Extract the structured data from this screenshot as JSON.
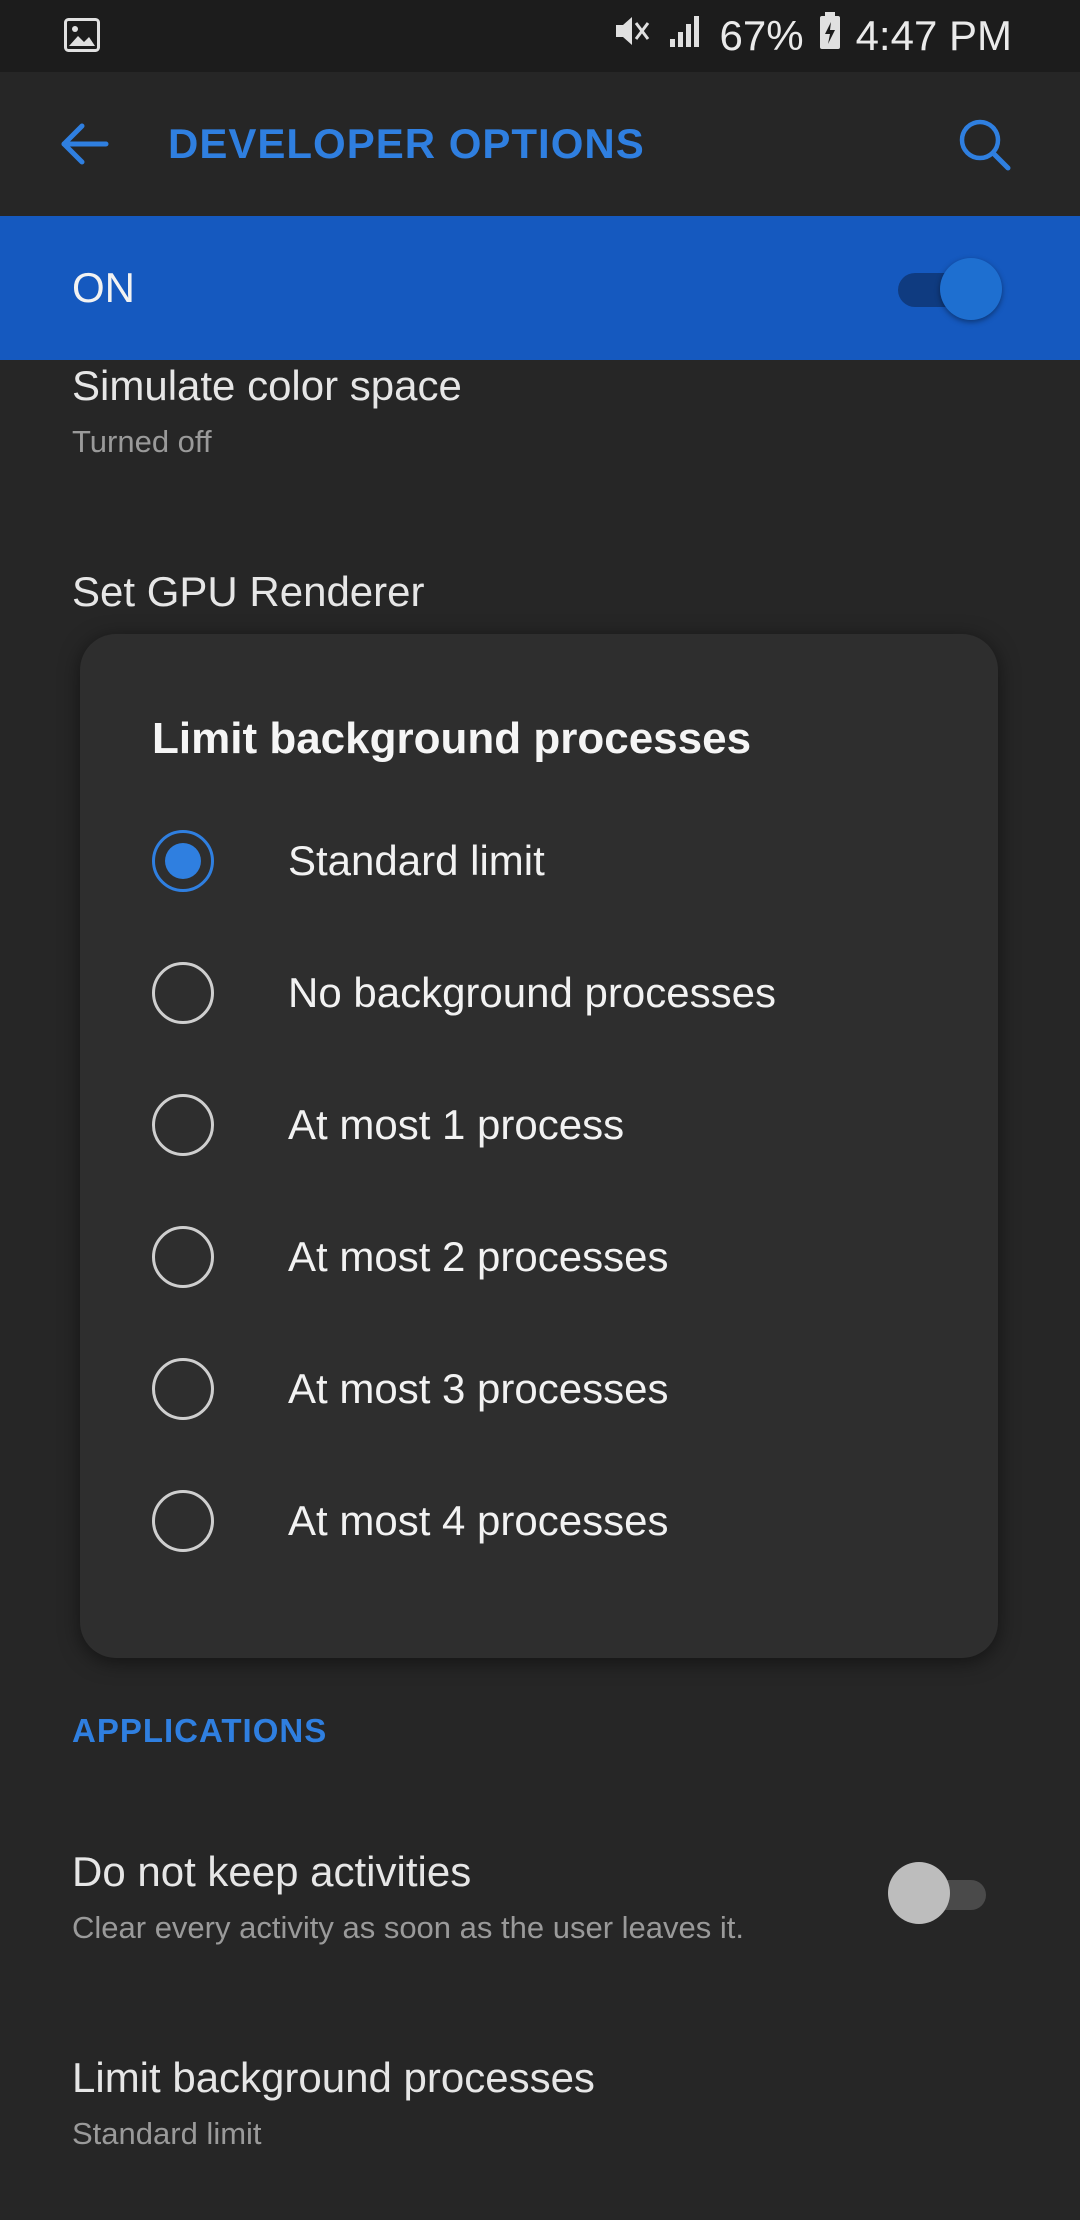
{
  "status_bar": {
    "battery": "67%",
    "time": "4:47 PM"
  },
  "app_bar": {
    "title": "DEVELOPER OPTIONS"
  },
  "master_switch": {
    "label": "ON",
    "enabled": true
  },
  "settings_above": [
    {
      "title": "Simulate color space",
      "subtitle": "Turned off"
    },
    {
      "title": "Set GPU Renderer"
    }
  ],
  "dialog": {
    "title": "Limit background processes",
    "options": [
      {
        "label": "Standard limit",
        "selected": true
      },
      {
        "label": "No background processes",
        "selected": false
      },
      {
        "label": "At most 1 process",
        "selected": false
      },
      {
        "label": "At most 2 processes",
        "selected": false
      },
      {
        "label": "At most 3 processes",
        "selected": false
      },
      {
        "label": "At most 4 processes",
        "selected": false
      }
    ]
  },
  "applications_section": {
    "header": "APPLICATIONS",
    "items": [
      {
        "title": "Do not keep activities",
        "subtitle": "Clear every activity as soon as the user leaves it.",
        "toggle_on": false
      },
      {
        "title": "Limit background processes",
        "subtitle": "Standard limit"
      }
    ]
  },
  "colors": {
    "accent": "#2f7fe0",
    "on_bar": "#1559bf",
    "background": "#262626",
    "dialog": "#2e2e2e"
  }
}
